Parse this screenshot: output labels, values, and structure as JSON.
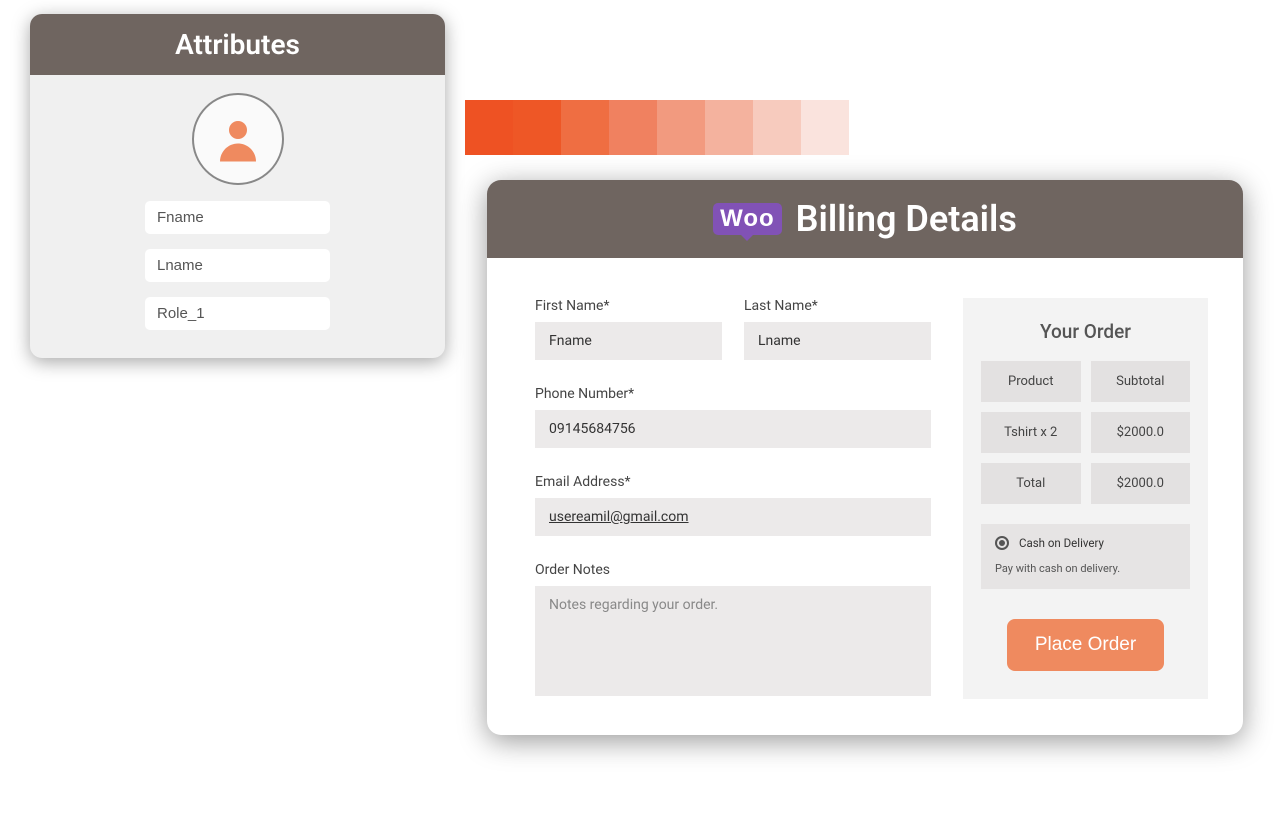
{
  "attributes": {
    "title": "Attributes",
    "fname": "Fname",
    "lname": "Lname",
    "role": "Role_1"
  },
  "billing": {
    "woo_label": "Woo",
    "title": "Billing Details",
    "first_name_label": "First Name*",
    "first_name_value": "Fname",
    "last_name_label": "Last Name*",
    "last_name_value": "Lname",
    "phone_label": "Phone Number*",
    "phone_value": "09145684756",
    "email_label": "Email Address*",
    "email_value": "usereamil@gmail.com",
    "notes_label": "Order Notes",
    "notes_placeholder": "Notes regarding your order."
  },
  "order": {
    "title": "Your Order",
    "col_product": "Product",
    "col_subtotal": "Subtotal",
    "item_name": "Tshirt x 2",
    "item_price": "$2000.0",
    "total_label": "Total",
    "total_value": "$2000.0",
    "payment_method": "Cash on Delivery",
    "payment_desc": "Pay with cash on delivery.",
    "place_order": "Place Order"
  },
  "strip_colors": [
    "#ee5223",
    "#ee5726",
    "#ef6e42",
    "#f08160",
    "#f29a7f",
    "#f4b29e",
    "#f7cbbe",
    "#fae3dd"
  ]
}
